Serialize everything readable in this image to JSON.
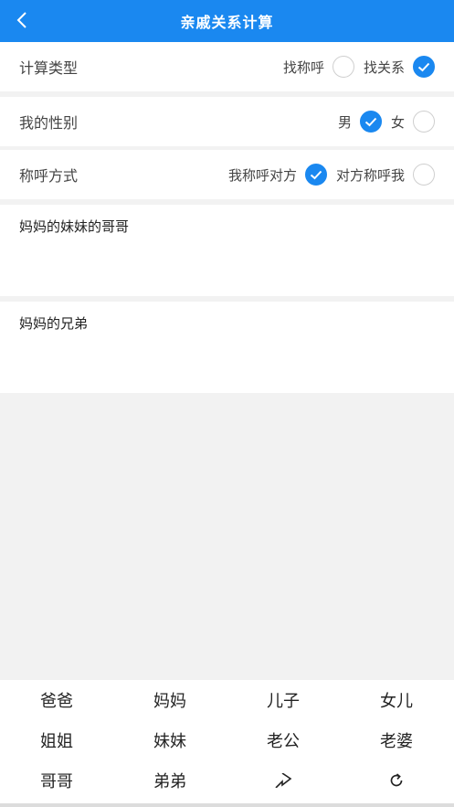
{
  "header": {
    "title": "亲戚关系计算",
    "back_icon": "chevron-left-icon",
    "color": "#1a88f0"
  },
  "settings": {
    "calc_type": {
      "label": "计算类型",
      "options": [
        {
          "label": "找称呼",
          "checked": false
        },
        {
          "label": "找关系",
          "checked": true
        }
      ]
    },
    "gender": {
      "label": "我的性别",
      "options": [
        {
          "label": "男",
          "checked": true
        },
        {
          "label": "女",
          "checked": false
        }
      ]
    },
    "address_mode": {
      "label": "称呼方式",
      "options": [
        {
          "label": "我称呼对方",
          "checked": true
        },
        {
          "label": "对方称呼我",
          "checked": false
        }
      ]
    }
  },
  "input_text": "妈妈的妹妹的哥哥",
  "result_text": "妈妈的兄弟",
  "keypad": {
    "rows": [
      [
        "爸爸",
        "妈妈",
        "儿子",
        "女儿"
      ],
      [
        "姐姐",
        "妹妹",
        "老公",
        "老婆"
      ],
      [
        "哥哥",
        "弟弟"
      ]
    ],
    "icons": [
      "share-arrow-icon",
      "refresh-icon"
    ]
  }
}
